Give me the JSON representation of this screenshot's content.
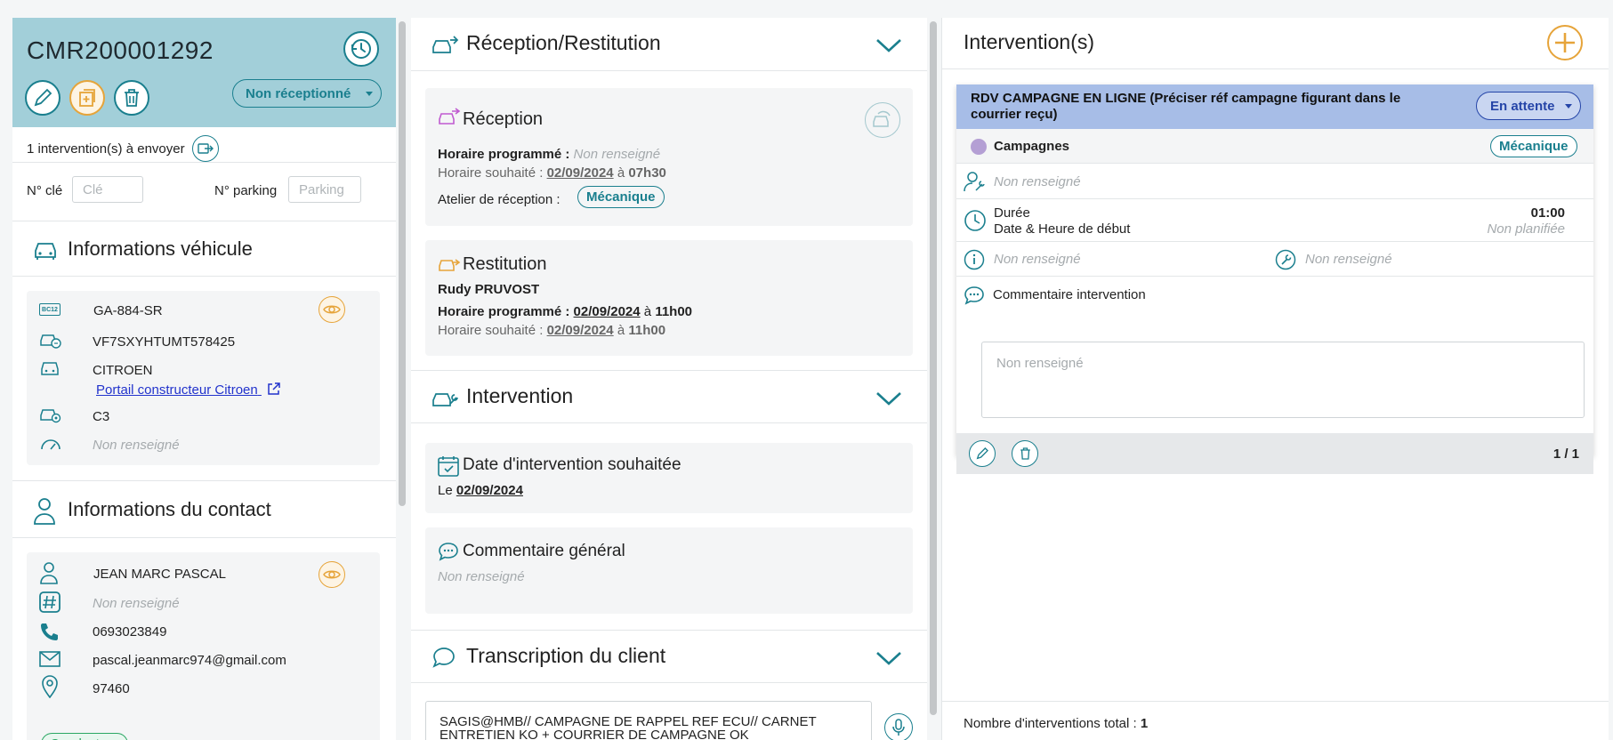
{
  "vehicle_panel": {
    "id": "CMR200001292",
    "status": "Non réceptionné",
    "interventions_to_send": "1 intervention(s) à envoyer",
    "key_label": "N° clé",
    "key_placeholder": "Clé",
    "parking_label": "N° parking",
    "parking_placeholder": "Parking",
    "vehicle_section_title": "Informations véhicule",
    "plate": "GA-884-SR",
    "vin": "VF7SXYHTUMT578425",
    "brand": "CITROEN",
    "portal_link": "Portail constructeur Citroen",
    "model": "C3",
    "mileage": "Non renseigné",
    "contact_section_title": "Informations du contact",
    "contact_name": "JEAN MARC PASCAL",
    "contact_number": "Non renseigné",
    "phone": "0693023849",
    "email": "pascal.jeanmarc974@gmail.com",
    "postcode": "97460",
    "role_tag": "Conducteur",
    "badge_code": "BC12"
  },
  "reception_panel": {
    "title": "Réception/Restitution",
    "reception": {
      "title": "Réception",
      "scheduled_label": "Horaire programmé :",
      "scheduled_value": "Non renseigné",
      "wished_label": "Horaire souhaité :",
      "wished_date": "02/09/2024",
      "wished_at": "à",
      "wished_time": "07h30",
      "workshop_label": "Atelier de réception :",
      "workshop_value": "Mécanique"
    },
    "restitution": {
      "title": "Restitution",
      "person": "Rudy PRUVOST",
      "scheduled_label": "Horaire programmé :",
      "scheduled_date": "02/09/2024",
      "scheduled_at": "à",
      "scheduled_time": "11h00",
      "wished_label": "Horaire souhaité :",
      "wished_date": "02/09/2024",
      "wished_at": "à",
      "wished_time": "11h00"
    },
    "intervention_title": "Intervention",
    "wished_date_title": "Date d'intervention souhaitée",
    "wished_date_prefix": "Le",
    "wished_date_value": "02/09/2024",
    "general_comment_title": "Commentaire général",
    "general_comment_value": "Non renseigné",
    "transcription_title": "Transcription du client",
    "transcription_text_line1": "SAGIS@HMB// CAMPAGNE DE RAPPEL REF ECU// CARNET",
    "transcription_text_line2": "ENTRETIEN KO + COURRIER DE CAMPAGNE OK"
  },
  "interventions_panel": {
    "title": "Intervention(s)",
    "card": {
      "title_line1": "RDV CAMPAGNE EN LIGNE (Préciser réf campagne figurant dans le",
      "title_line2": "courrier reçu)",
      "status": "En attente",
      "category": "Campagnes",
      "workshop_tag": "Mécanique",
      "technician": "Non renseigné",
      "duration_label": "Durée",
      "duration_value": "01:00",
      "start_label": "Date & Heure de début",
      "start_value": "Non planifiée",
      "info_value": "Non renseigné",
      "tool_value": "Non renseigné",
      "comment_label": "Commentaire intervention",
      "comment_placeholder": "Non renseigné",
      "pager": "1 / 1"
    },
    "total_label": "Nombre d'interventions total :",
    "total_value": "1"
  },
  "colors": {
    "teal": "#1a7f8e",
    "header_bg": "#a2cfd9",
    "card_header_bg": "#a7bde7",
    "orange": "#e6a43a",
    "category_dot": "#b49fd4"
  }
}
